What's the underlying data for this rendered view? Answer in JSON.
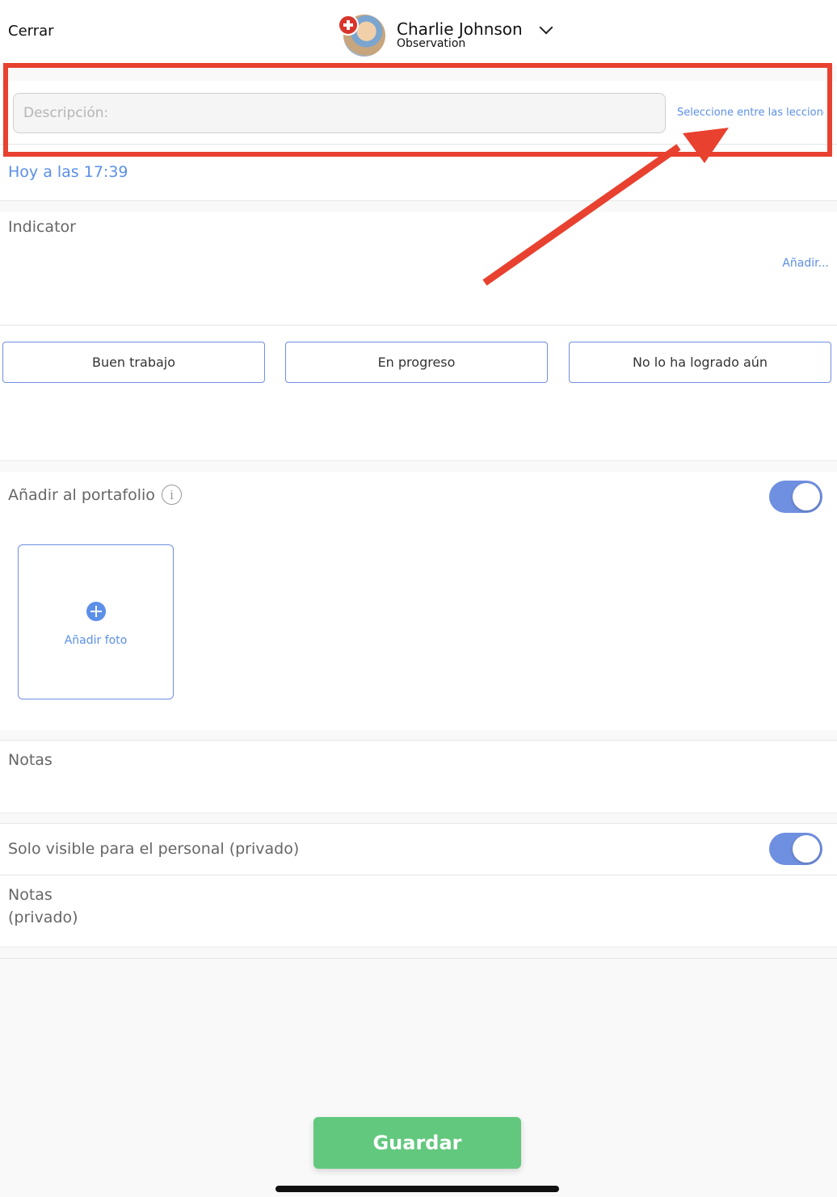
{
  "header": {
    "close_label": "Cerrar",
    "student_name": "Charlie Johnson",
    "student_subtitle": "Observation"
  },
  "description": {
    "placeholder": "Descripción:",
    "value": "",
    "lesson_link": "Seleccione entre las lecciones"
  },
  "date": {
    "label": "Hoy a las 17:39"
  },
  "indicator": {
    "label": "Indicator",
    "add_label": "Añadir..."
  },
  "assessment": {
    "options": [
      "Buen trabajo",
      "En progreso",
      "No lo ha logrado aún"
    ]
  },
  "portfolio": {
    "label": "Añadir al portafolio",
    "info_glyph": "i",
    "enabled": true,
    "add_photo_label": "Añadir foto"
  },
  "notes": {
    "label": "Notas"
  },
  "private": {
    "label": "Solo visible para el personal (privado)",
    "enabled": true,
    "notes_label": "Notas (privado)"
  },
  "footer": {
    "save_label": "Guardar"
  },
  "colors": {
    "accent": "#5b8fe8",
    "toggle_on": "#6f8fe0",
    "save_green": "#62c87e",
    "highlight_red": "#e8412f"
  }
}
